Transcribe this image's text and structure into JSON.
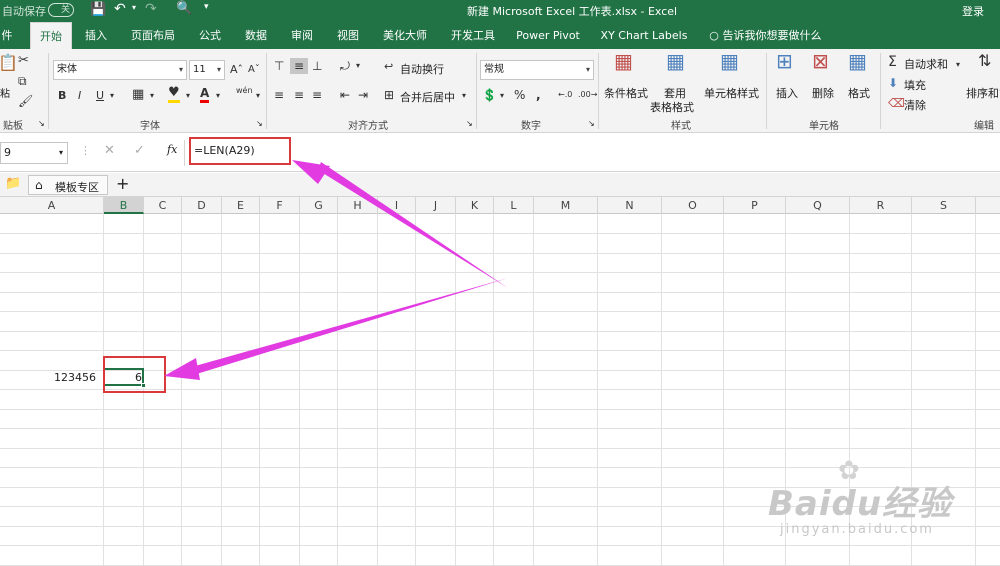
{
  "titlebar": {
    "autosave": "自动保存",
    "autosave_toggle": "关",
    "title": "新建 Microsoft Excel 工作表.xlsx  -  Excel",
    "login": "登录"
  },
  "tabs": [
    {
      "label": "件"
    },
    {
      "label": "开始"
    },
    {
      "label": "插入"
    },
    {
      "label": "页面布局"
    },
    {
      "label": "公式"
    },
    {
      "label": "数据"
    },
    {
      "label": "审阅"
    },
    {
      "label": "视图"
    },
    {
      "label": "美化大师"
    },
    {
      "label": "开发工具"
    },
    {
      "label": "Power Pivot"
    },
    {
      "label": "XY Chart Labels"
    },
    {
      "label": "告诉我你想要做什么"
    }
  ],
  "ribbon": {
    "paste_label": "粘",
    "clipboard_label": "贴板",
    "font_name": "宋体",
    "font_size": "11",
    "font_group": "字体",
    "wrap_text": "自动换行",
    "merge_center": "合并后居中",
    "align_group": "对齐方式",
    "number_format": "常规",
    "number_group": "数字",
    "cond_format": "条件格式",
    "table_format_1": "套用",
    "table_format_2": "表格格式",
    "cell_style": "单元格样式",
    "style_group": "样式",
    "insert": "插入",
    "delete": "删除",
    "format": "格式",
    "cells_group": "单元格",
    "autosum": "自动求和",
    "fill": "填充",
    "clear": "清除",
    "sort_filter": "排序和筛",
    "edit_group": "编辑",
    "bold": "B",
    "italic": "I",
    "underline": "U",
    "wen": "wén"
  },
  "formula_bar": {
    "name_box": "9",
    "formula": "=LEN(A29)",
    "fx": "fx"
  },
  "sheet_tabs": {
    "template_tab": "模板专区",
    "add": "+"
  },
  "columns": [
    "A",
    "B",
    "C",
    "D",
    "E",
    "F",
    "G",
    "H",
    "I",
    "J",
    "K",
    "L",
    "M",
    "N",
    "O",
    "P",
    "Q",
    "R",
    "S"
  ],
  "cells": {
    "a_value": "123456",
    "b_value": "6"
  },
  "watermark": {
    "brand": "Baidu经验",
    "url": "jingyan.baidu.com"
  },
  "colors": {
    "brand": "#217346",
    "annotation_red": "#d9393b",
    "annotation_arrow": "#e23be2"
  }
}
